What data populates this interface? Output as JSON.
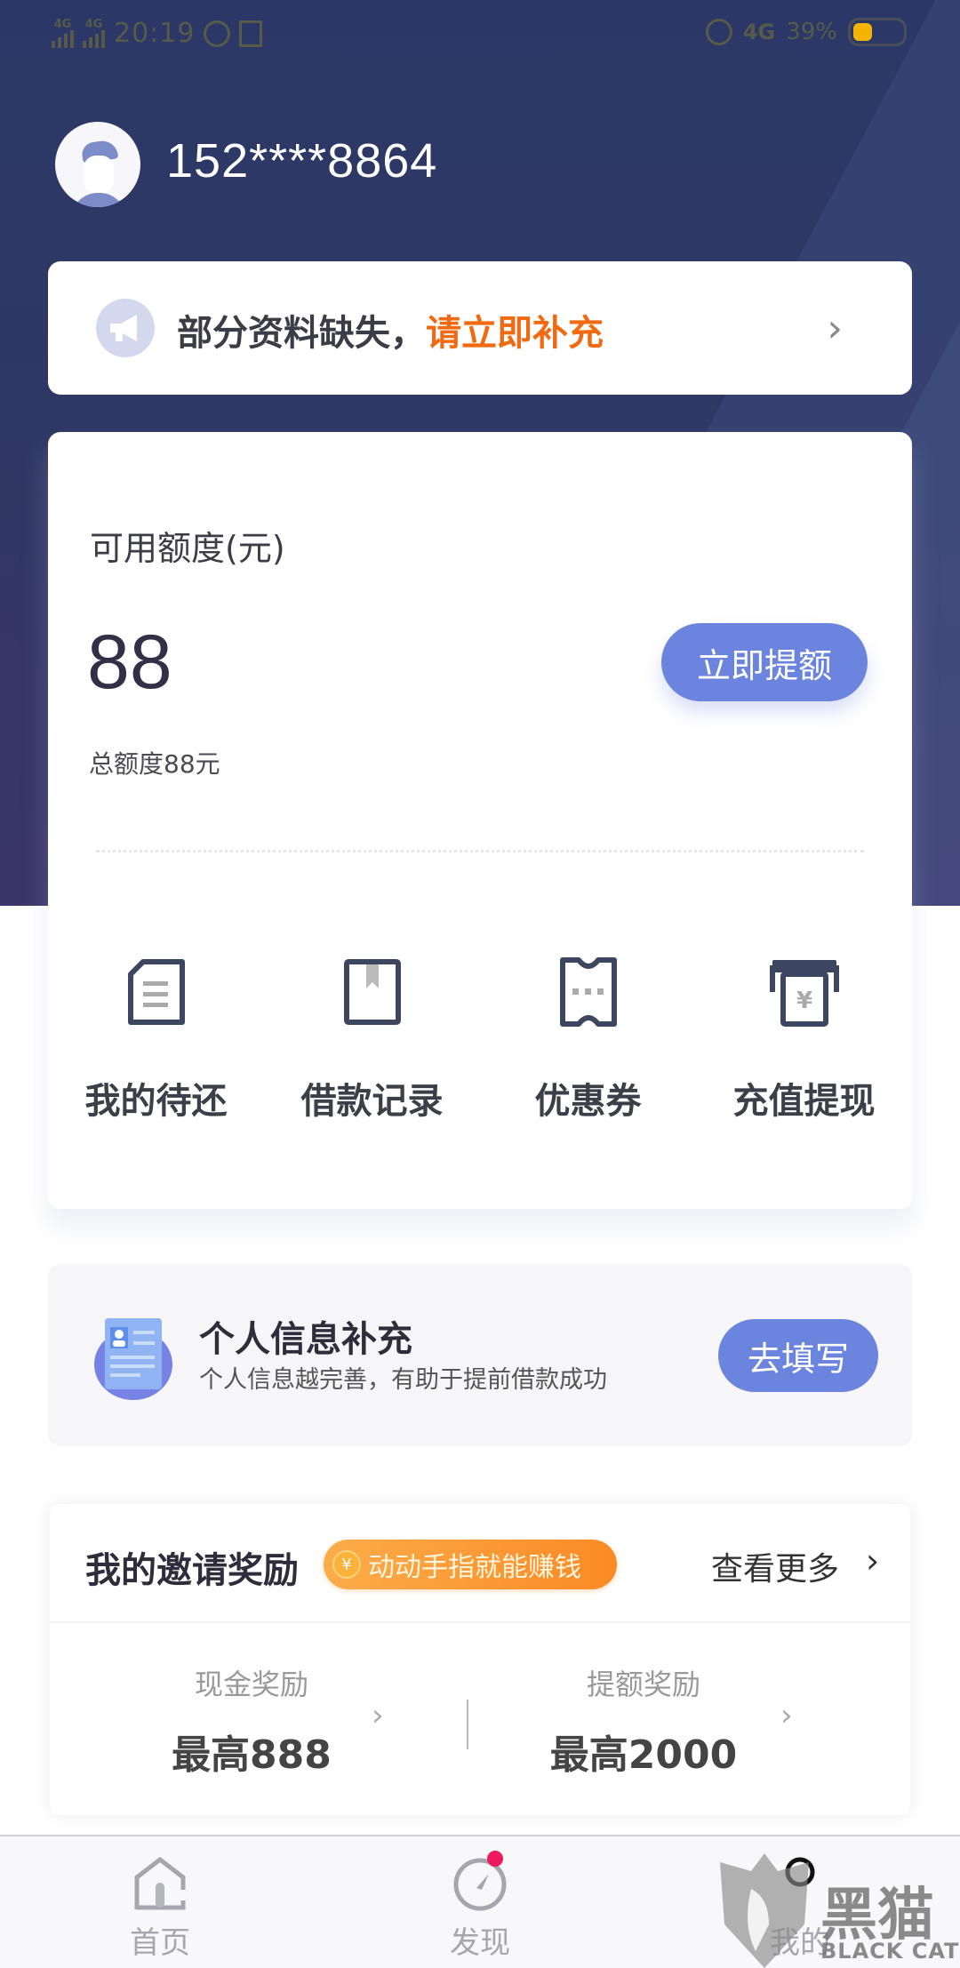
{
  "status_bar": {
    "signal1_label": "4G",
    "signal2_label": "4G",
    "time": "20:19",
    "network": "4G",
    "battery_percent_text": "39%",
    "battery_level": 0.39,
    "battery_color": "#f4b400"
  },
  "profile": {
    "phone_masked": "152****8864",
    "avatar_icon": "user-avatar-icon"
  },
  "notice": {
    "icon": "megaphone-icon",
    "text": "部分资料缺失，",
    "highlight": "请立即补充",
    "highlight_color": "#f06a12",
    "chevron": "›"
  },
  "credit": {
    "available_label": "可用额度(元)",
    "available_amount": "88",
    "total_text": "总额度88元",
    "raise_button": "立即提额"
  },
  "quick_actions": [
    {
      "label": "我的待还",
      "icon": "document-icon"
    },
    {
      "label": "借款记录",
      "icon": "bookmark-book-icon"
    },
    {
      "label": "优惠券",
      "icon": "ticket-icon"
    },
    {
      "label": "充值提现",
      "icon": "yuan-withdraw-icon"
    }
  ],
  "info_card": {
    "title": "个人信息补充",
    "subtitle": "个人信息越完善，有助于提前借款成功",
    "button": "去填写",
    "icon": "id-card-icon"
  },
  "invite": {
    "title": "我的邀请奖励",
    "badge": "动动手指就能赚钱",
    "badge_coin": "¥",
    "more": "查看更多",
    "chevron": "›",
    "rewards": [
      {
        "label": "现金奖励",
        "value": "最高888"
      },
      {
        "label": "提额奖励",
        "value": "最高2000"
      }
    ]
  },
  "tab_bar": {
    "tabs": [
      {
        "label": "首页",
        "icon": "home-icon"
      },
      {
        "label": "发现",
        "icon": "compass-icon",
        "badge": true
      },
      {
        "label": "我的",
        "icon": "user-icon"
      }
    ],
    "badge_color": "#ee1b5c"
  },
  "watermark": {
    "text": "黑猫",
    "sub": "BLACK CAT"
  },
  "colors": {
    "header_bg": "#2b3867",
    "accent_button": "#6b84dd",
    "orange": "#fb8a24"
  }
}
